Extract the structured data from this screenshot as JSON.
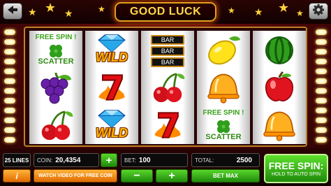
{
  "header": {
    "title": "GOOD LUCK"
  },
  "reels": {
    "col1": {
      "free_spin": "FREE SPIN !",
      "scatter": "SCATTER"
    },
    "col2": {
      "wild_top": "WILD",
      "wild_bottom": "WILD"
    },
    "col3": {
      "bar_top": "BAR",
      "bar_mid": "BAR",
      "bar_bottom": "BAR"
    },
    "col4": {
      "free_spin": "FREE SPIN !",
      "scatter": "SCATTER"
    }
  },
  "panel": {
    "lines": "25 LINES",
    "coin_label": "COIN:",
    "coin_value": "20,4354",
    "plus": "+",
    "minus": "−",
    "bet_label": "BET:",
    "bet_value": "100",
    "total_label": "TOTAL:",
    "total_value": "2500",
    "info": "i",
    "watch_video": "WATCH VIDEO FOR FREE COIN",
    "bet_max": "BET MAX",
    "free_spin": "FREE SPIN:",
    "hold_auto": "HOLD TO AUTO SPIN"
  },
  "colors": {
    "accent": "#ffd23a",
    "button_green": "#3fbf1a",
    "button_orange": "#f08a10",
    "background": "#4a0606"
  },
  "icons": [
    "back-icon",
    "gear-icon",
    "star-icon",
    "diamond-icon",
    "seven-icon",
    "cherry-icon",
    "grapes-icon",
    "clover-icon",
    "lemon-icon",
    "bell-icon",
    "watermelon-icon",
    "apple-icon",
    "info-icon"
  ]
}
